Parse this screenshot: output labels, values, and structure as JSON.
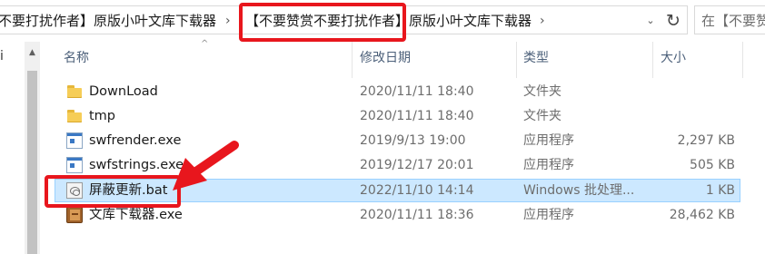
{
  "address_bar": {
    "crumbs": [
      "不要打扰作者】原版小叶文库下载器",
      "【不要赞赏不要打扰作者】原版小叶文库下载器"
    ],
    "separator": "›",
    "dropdown_glyph": "⌄",
    "refresh_glyph": "↻",
    "search_placeholder": "在【不要赞"
  },
  "nav": {
    "scroll_up_glyph": "▲",
    "partial_label": "i"
  },
  "columns": {
    "name": "名称",
    "date": "修改日期",
    "type": "类型",
    "size": "大小",
    "sort_glyph": "^"
  },
  "files": [
    {
      "name": "DownLoad",
      "date": "2020/11/11 18:40",
      "type": "文件夹",
      "size": "",
      "icon": "folder-icon"
    },
    {
      "name": "tmp",
      "date": "2020/11/11 18:40",
      "type": "文件夹",
      "size": "",
      "icon": "folder-icon"
    },
    {
      "name": "swfrender.exe",
      "date": "2019/9/13 19:00",
      "type": "应用程序",
      "size": "2,297 KB",
      "icon": "exe-icon"
    },
    {
      "name": "swfstrings.exe",
      "date": "2019/12/17 20:01",
      "type": "应用程序",
      "size": "505 KB",
      "icon": "exe-icon"
    },
    {
      "name": "屏蔽更新.bat",
      "date": "2022/11/10 14:14",
      "type": "Windows 批处理...",
      "size": "1 KB",
      "icon": "bat-icon",
      "selected": true
    },
    {
      "name": "文库下载器.exe",
      "date": "2020/11/11 18:36",
      "type": "应用程序",
      "size": "28,462 KB",
      "icon": "book-icon"
    }
  ],
  "colors": {
    "selection_bg": "#cce8ff",
    "selection_border": "#99d1ff",
    "annotation_red": "#e8161d",
    "header_text": "#4c607a"
  }
}
